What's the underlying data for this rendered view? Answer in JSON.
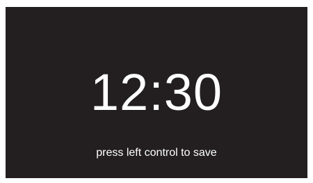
{
  "screen": {
    "time": "12:30",
    "hint": "press left control to save",
    "background_color": "#231f20",
    "text_color": "#ffffff"
  }
}
